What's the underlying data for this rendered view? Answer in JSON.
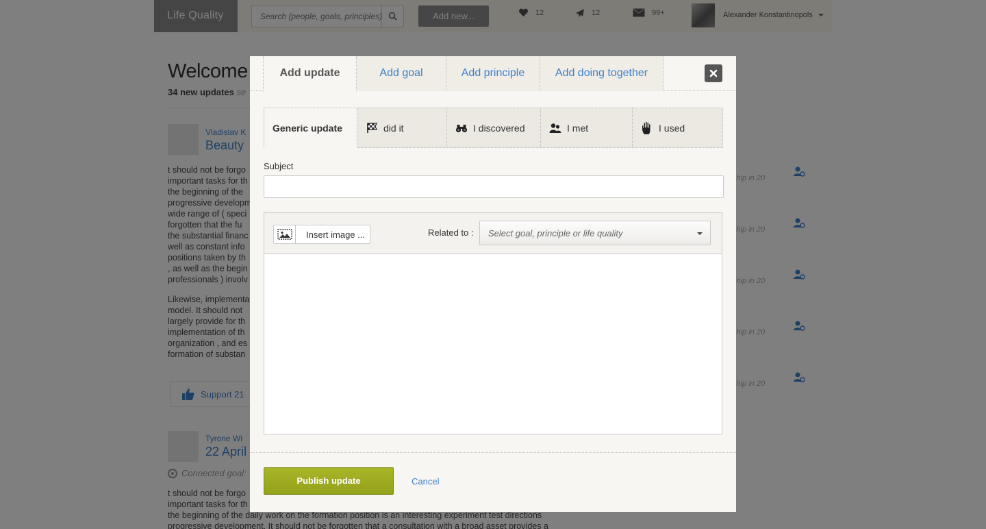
{
  "header": {
    "logo": "Life Quality",
    "search_placeholder": "Search (people, goals, principles)",
    "add_new": "Add new...",
    "likes_count": "12",
    "sent_count": "12",
    "messages_count": "99+",
    "user_name": "Alexander Konstantinopols"
  },
  "feed": {
    "welcome": "Welcome",
    "new_updates": "34 new updates",
    "see_label": "se",
    "posts": [
      {
        "author": "Vladislav K",
        "title": "Beauty",
        "paragraphs": [
          "t should not be forgo\nimportant tasks for th\nthe beginning of the \nprogressive developm\nwide range of ( speci\nforgotten that the fu\nthe substantial financ\nwell as constant info\npositions taken by th\n, as well as the begin\nprofessionals ) involv",
          "Likewise, implementa\nmodel. It should not \nlargely provide for th\nimplementation of th\norganization , and es\nformation of substan"
        ],
        "support": "Support 21"
      },
      {
        "author": "Tyrone Wi",
        "title": "22 April",
        "connected_goal": "Connected goal:",
        "text": "t should not be forgo\nimportant tasks for th\nthe beginning of the daily work on the formation position is an interesting experiment test directions\nprogressive development. It should not be forgotten that a consultation with a broad asset provides a"
      }
    ]
  },
  "sidebar": {
    "rows": [
      "ship in 20",
      "ship in 20",
      "ship in 20",
      "ship in 20",
      "ship in 20"
    ]
  },
  "modal": {
    "tabs": [
      "Add update",
      "Add goal",
      "Add principle",
      "Add doing together"
    ],
    "active_tab": "Add update",
    "subtabs": [
      {
        "label": "Generic update",
        "icon": "none"
      },
      {
        "label": "did it",
        "icon": "checkered-flag-icon"
      },
      {
        "label": "I discovered",
        "icon": "binoculars-icon"
      },
      {
        "label": "I met",
        "icon": "people-icon"
      },
      {
        "label": "I used",
        "icon": "hand-icon"
      }
    ],
    "subject_label": "Subject",
    "subject_value": "",
    "insert_image": "Insert image ...",
    "related_label": "Related to :",
    "related_placeholder": "Select goal, principle or life quality",
    "body_value": "",
    "publish": "Publish update",
    "cancel": "Cancel"
  },
  "colors": {
    "link": "#3d80c9",
    "publish": "#9aa720",
    "overlay": "rgba(0,0,0,0.5)",
    "modal_bg": "#f7f6f2"
  }
}
